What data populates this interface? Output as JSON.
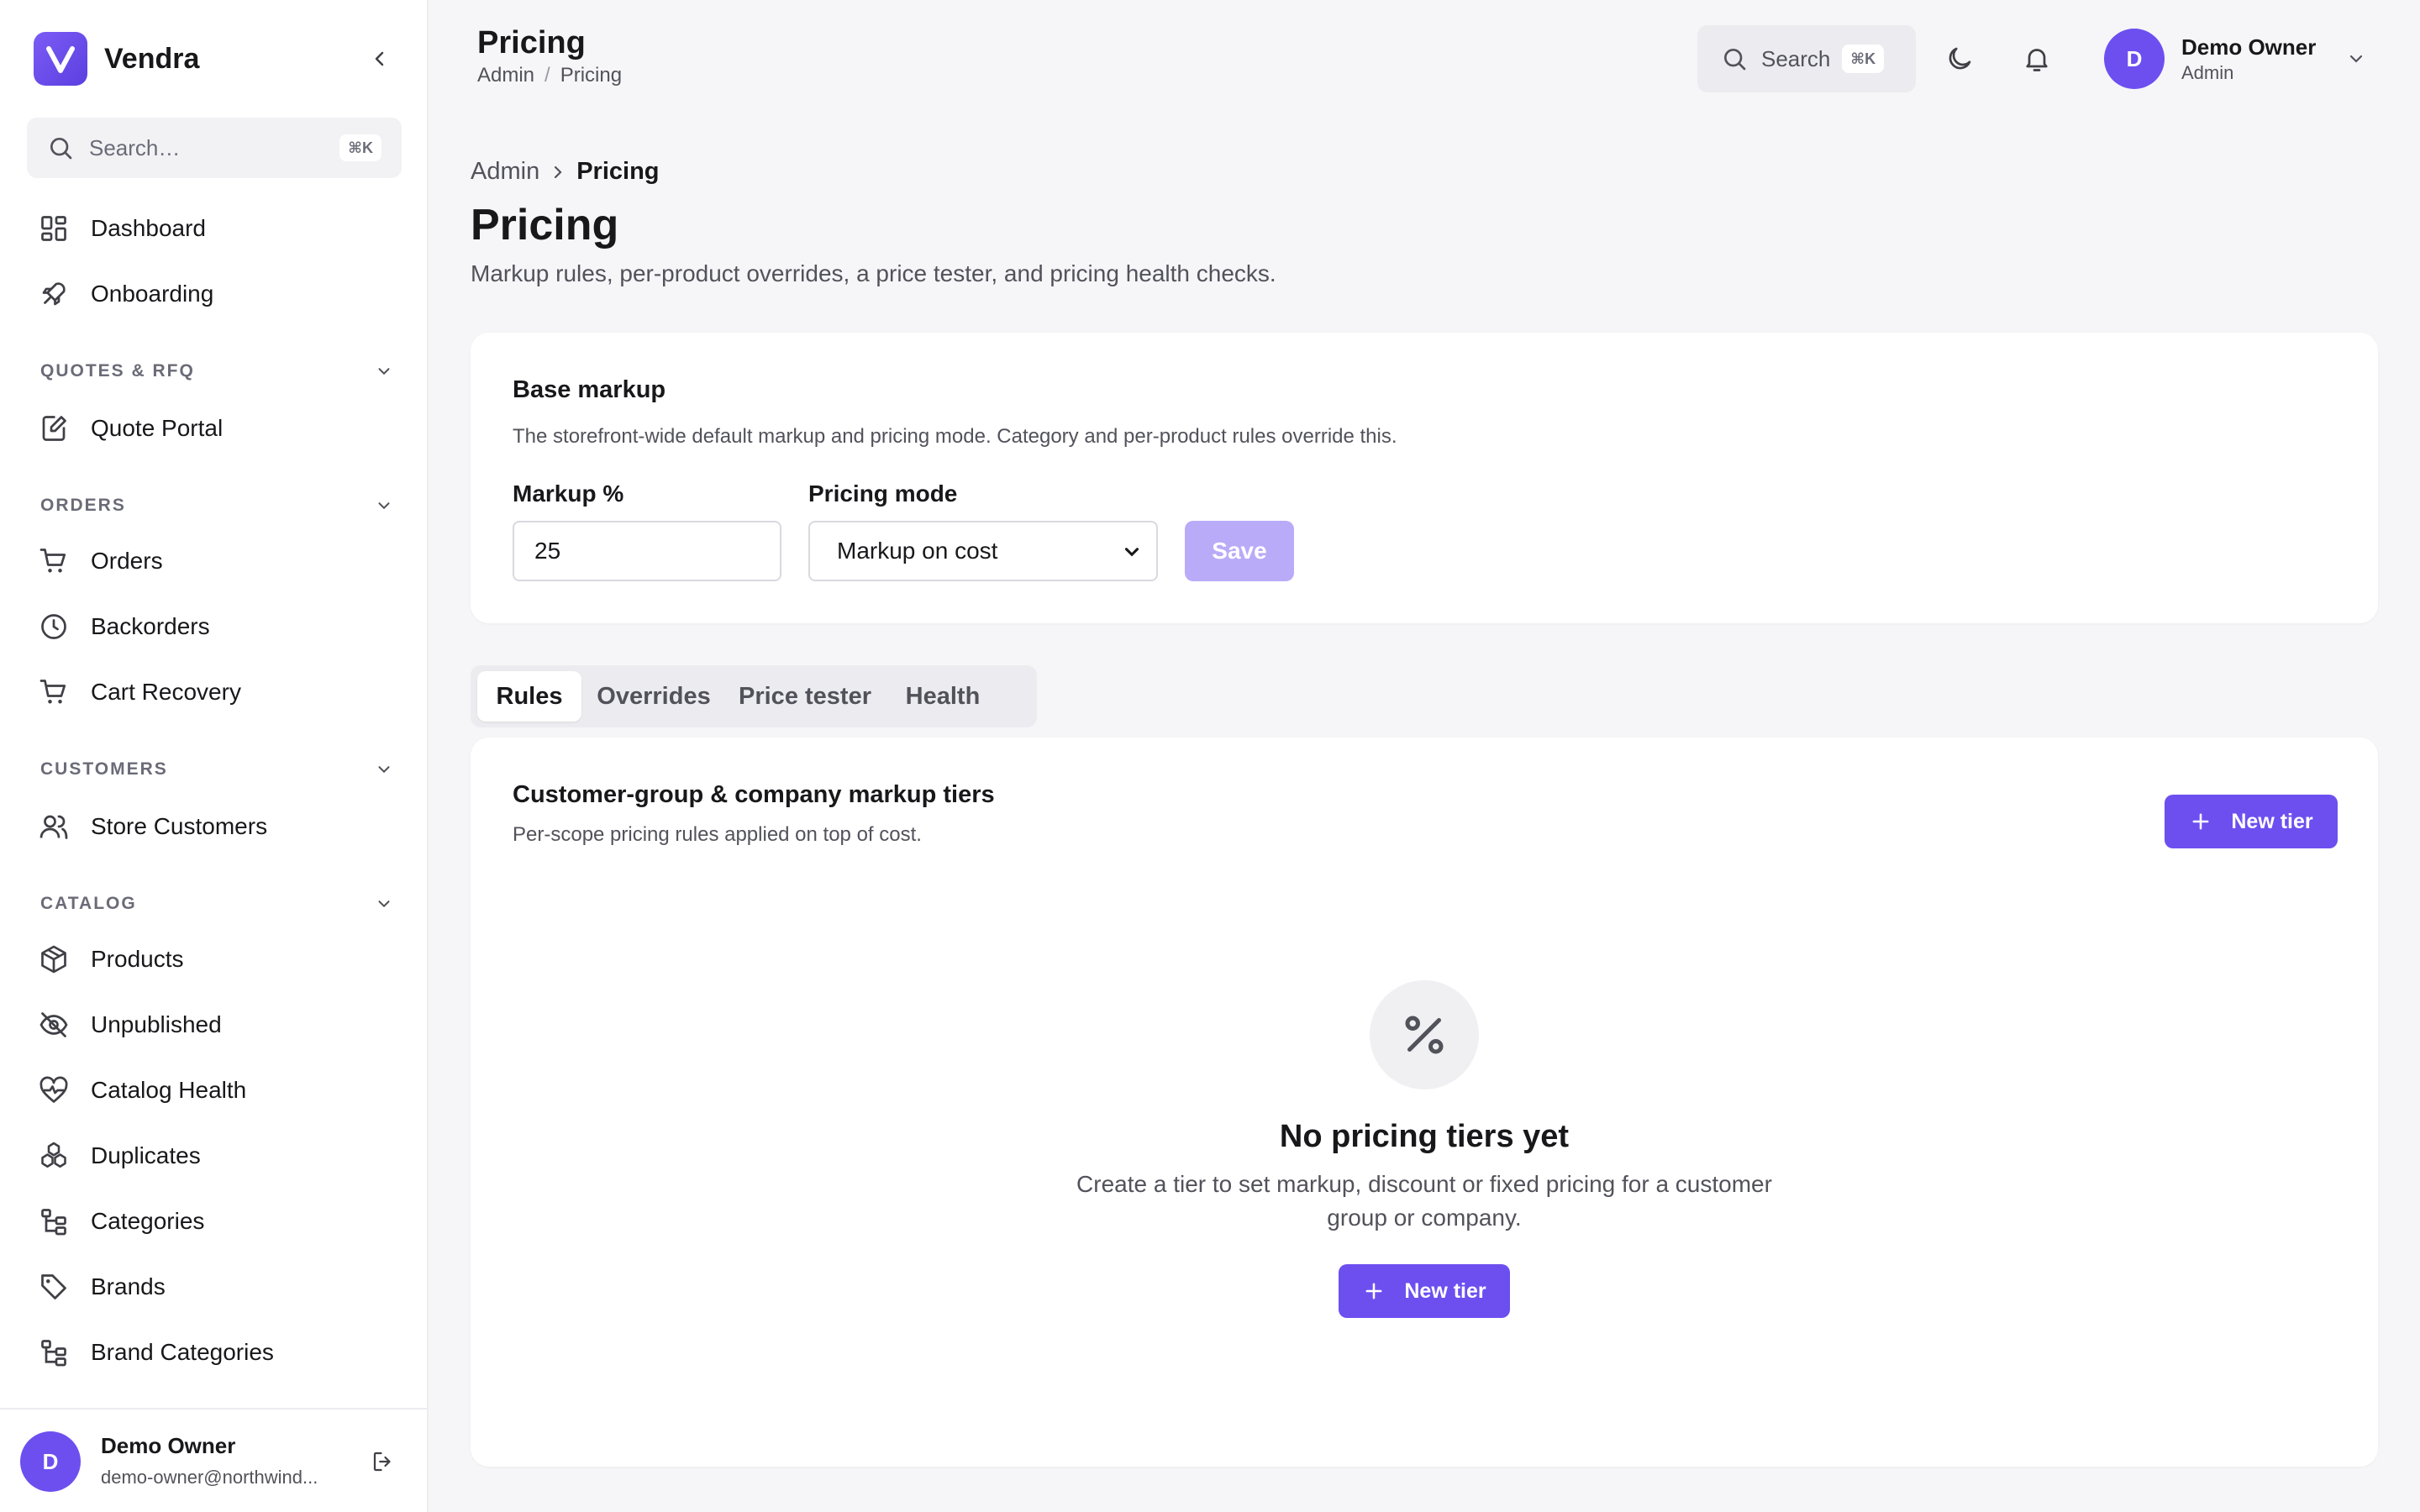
{
  "app": {
    "name": "Vendra"
  },
  "sidebar": {
    "search_placeholder": "Search…",
    "search_shortcut": "⌘K",
    "items_top": [
      {
        "label": "Dashboard",
        "icon": "grid-icon"
      },
      {
        "label": "Onboarding",
        "icon": "rocket-icon"
      }
    ],
    "sections": [
      {
        "label": "QUOTES & RFQ",
        "items": [
          {
            "label": "Quote Portal",
            "icon": "document-edit-icon"
          }
        ]
      },
      {
        "label": "ORDERS",
        "items": [
          {
            "label": "Orders",
            "icon": "cart-icon"
          },
          {
            "label": "Backorders",
            "icon": "clock-icon"
          },
          {
            "label": "Cart Recovery",
            "icon": "cart-icon"
          }
        ]
      },
      {
        "label": "CUSTOMERS",
        "items": [
          {
            "label": "Store Customers",
            "icon": "users-icon"
          }
        ]
      },
      {
        "label": "CATALOG",
        "items": [
          {
            "label": "Products",
            "icon": "package-icon"
          },
          {
            "label": "Unpublished",
            "icon": "eye-off-icon"
          },
          {
            "label": "Catalog Health",
            "icon": "heart-pulse-icon"
          },
          {
            "label": "Duplicates",
            "icon": "boxes-icon"
          },
          {
            "label": "Categories",
            "icon": "tree-icon"
          },
          {
            "label": "Brands",
            "icon": "tag-icon"
          },
          {
            "label": "Brand Categories",
            "icon": "tree-icon"
          }
        ]
      }
    ],
    "footer": {
      "avatar_letter": "D",
      "name": "Demo Owner",
      "email": "demo-owner@northwind..."
    }
  },
  "header": {
    "title": "Pricing",
    "breadcrumb": [
      "Admin",
      "/",
      "Pricing"
    ],
    "search_label": "Search",
    "search_shortcut": "⌘K",
    "user": {
      "avatar_letter": "D",
      "name": "Demo Owner",
      "role": "Admin"
    }
  },
  "main": {
    "breadcrumb": {
      "parent": "Admin",
      "current": "Pricing"
    },
    "title": "Pricing",
    "subtitle": "Markup rules, per-product overrides, a price tester, and pricing health checks.",
    "base_markup": {
      "title": "Base markup",
      "description": "The storefront-wide default markup and pricing mode. Category and per-product rules override this.",
      "markup_label": "Markup %",
      "markup_value": "25",
      "mode_label": "Pricing mode",
      "mode_value": "Markup on cost",
      "save_label": "Save"
    },
    "tabs": [
      "Rules",
      "Overrides",
      "Price tester",
      "Health"
    ],
    "active_tab": "Rules",
    "tiers": {
      "title": "Customer-group & company markup tiers",
      "subtitle": "Per-scope pricing rules applied on top of cost.",
      "new_tier_label": "New tier",
      "empty_title": "No pricing tiers yet",
      "empty_text": "Create a tier to set markup, discount or fixed pricing for a customer group or company.",
      "empty_button": "New tier"
    }
  },
  "colors": {
    "accent": "#6d4ff0",
    "accent_disabled": "#b9abf8",
    "background": "#f6f6f8"
  }
}
